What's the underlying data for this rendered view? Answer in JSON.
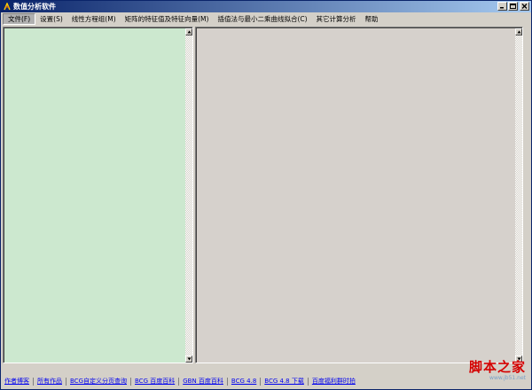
{
  "window": {
    "title": "数值分析软件"
  },
  "menu": {
    "items": [
      {
        "label": "文件(F)",
        "active": true
      },
      {
        "label": "设置(S)"
      },
      {
        "label": "线性方程组(M)"
      },
      {
        "label": "矩阵的特征值及特征向量(M)"
      },
      {
        "label": "插值法与最小二乘曲线拟合(C)"
      },
      {
        "label": "其它计算分析"
      },
      {
        "label": "帮助"
      }
    ]
  },
  "links": [
    "作者博客",
    "所有作品",
    "BCG自定义分页查询",
    "BCG 百度百科",
    "GBN 百度百科",
    "BCG 4.8",
    "BCG 4.8 下载",
    "百度福利群时拍"
  ],
  "watermark": {
    "main": "脚本之家",
    "sub": "www.jb51.net"
  },
  "colors": {
    "left_panel_bg": "#cce8cf",
    "right_panel_bg": "#d6d1cc",
    "titlebar_start": "#0a246a",
    "titlebar_end": "#a6caf0",
    "link": "#0000ee",
    "watermark": "#d40000"
  }
}
